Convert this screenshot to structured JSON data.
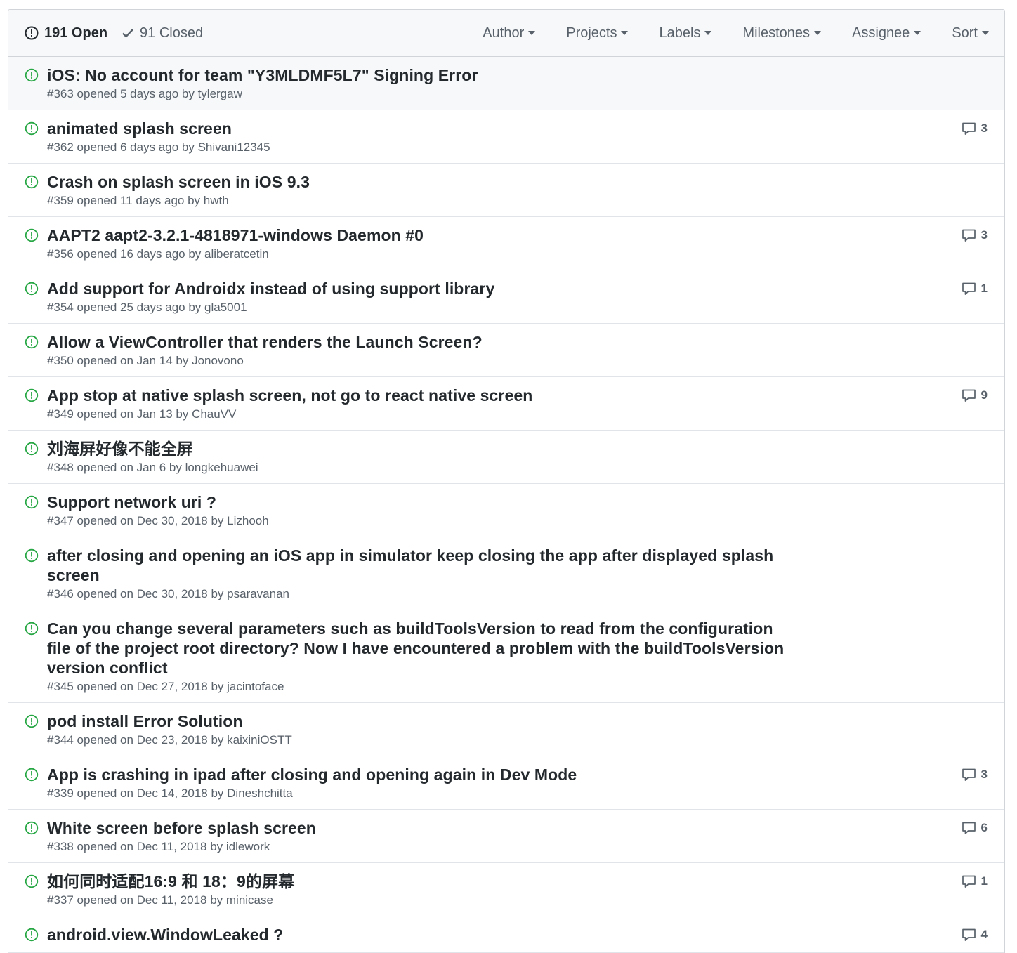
{
  "header": {
    "open_label": "191 Open",
    "closed_label": "91 Closed",
    "filters": [
      "Author",
      "Projects",
      "Labels",
      "Milestones",
      "Assignee",
      "Sort"
    ]
  },
  "colors": {
    "open_green": "#28a745",
    "muted": "#586069",
    "text": "#24292e"
  },
  "issues": [
    {
      "title": "iOS: No account for team \"Y3MLDMF5L7\" Signing Error",
      "meta": "#363 opened 5 days ago by tylergaw",
      "comments": ""
    },
    {
      "title": "animated splash screen",
      "meta": "#362 opened 6 days ago by Shivani12345",
      "comments": "3"
    },
    {
      "title": "Crash on splash screen in iOS 9.3",
      "meta": "#359 opened 11 days ago by hwth",
      "comments": ""
    },
    {
      "title": "AAPT2 aapt2-3.2.1-4818971-windows Daemon #0",
      "meta": "#356 opened 16 days ago by aliberatcetin",
      "comments": "3"
    },
    {
      "title": "Add support for Androidx instead of using support library",
      "meta": "#354 opened 25 days ago by gla5001",
      "comments": "1"
    },
    {
      "title": "Allow a ViewController that renders the Launch Screen?",
      "meta": "#350 opened on Jan 14 by Jonovono",
      "comments": ""
    },
    {
      "title": "App stop at native splash screen, not go to react native screen",
      "meta": "#349 opened on Jan 13 by ChauVV",
      "comments": "9"
    },
    {
      "title": "刘海屏好像不能全屏",
      "meta": "#348 opened on Jan 6 by longkehuawei",
      "comments": ""
    },
    {
      "title": "Support network uri ?",
      "meta": "#347 opened on Dec 30, 2018 by Lizhooh",
      "comments": ""
    },
    {
      "title": "after closing and opening an iOS app in simulator keep closing the app after displayed splash screen",
      "meta": "#346 opened on Dec 30, 2018 by psaravanan",
      "comments": ""
    },
    {
      "title": "Can you change several parameters such as buildToolsVersion to read from the configuration file of the project root directory? Now I have encountered a problem with the buildToolsVersion version conflict",
      "meta": "#345 opened on Dec 27, 2018 by jacintoface",
      "comments": ""
    },
    {
      "title": "pod install Error Solution",
      "meta": "#344 opened on Dec 23, 2018 by kaixiniOSTT",
      "comments": ""
    },
    {
      "title": "App is crashing in ipad after closing and opening again in Dev Mode",
      "meta": "#339 opened on Dec 14, 2018 by Dineshchitta",
      "comments": "3"
    },
    {
      "title": "White screen before splash screen",
      "meta": "#338 opened on Dec 11, 2018 by idlework",
      "comments": "6"
    },
    {
      "title": "如何同时适配16:9 和 18：9的屏幕",
      "meta": "#337 opened on Dec 11, 2018 by minicase",
      "comments": "1"
    },
    {
      "title": "android.view.WindowLeaked ?",
      "meta": "",
      "comments": "4"
    }
  ]
}
